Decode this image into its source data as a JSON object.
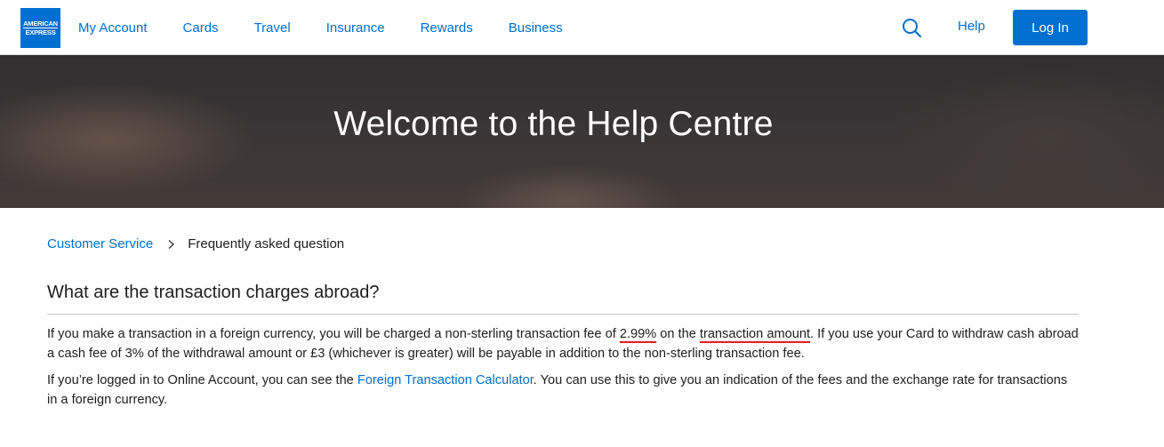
{
  "brand": {
    "logo_line1": "AMERICAN",
    "logo_line2": "EXPRESS",
    "color": "#006fcf"
  },
  "nav": {
    "items": [
      {
        "label": "My Account"
      },
      {
        "label": "Cards"
      },
      {
        "label": "Travel"
      },
      {
        "label": "Insurance"
      },
      {
        "label": "Rewards"
      },
      {
        "label": "Business"
      }
    ],
    "search_icon": "search-icon",
    "help_label": "Help",
    "login_label": "Log In"
  },
  "hero": {
    "title": "Welcome to the Help Centre"
  },
  "breadcrumb": {
    "link": "Customer Service",
    "separator_icon": "chevron-right-icon",
    "current": "Frequently asked question"
  },
  "faq": {
    "question": "What are the transaction charges abroad?",
    "p1": {
      "t1": "If you make a transaction in a foreign currency, you will be charged a non-sterling transaction fee of ",
      "fee": "2.99%",
      "t2": " on the ",
      "amount": "transaction amount",
      "t3": ". If you use your Card to withdraw cash abroad a cash fee of 3% of the withdrawal amount or £3 (whichever is greater) will be payable in addition to the non-sterling transaction fee."
    },
    "p2": {
      "t1": "If you’re logged in to Online Account, you can see the ",
      "link": "Foreign Transaction Calculator",
      "t2": ". You can use this to give you an indication of the fees and the exchange rate for transactions in a foreign currency."
    }
  },
  "colors": {
    "link": "#006fcf",
    "annotation_underline": "#e0201b"
  }
}
